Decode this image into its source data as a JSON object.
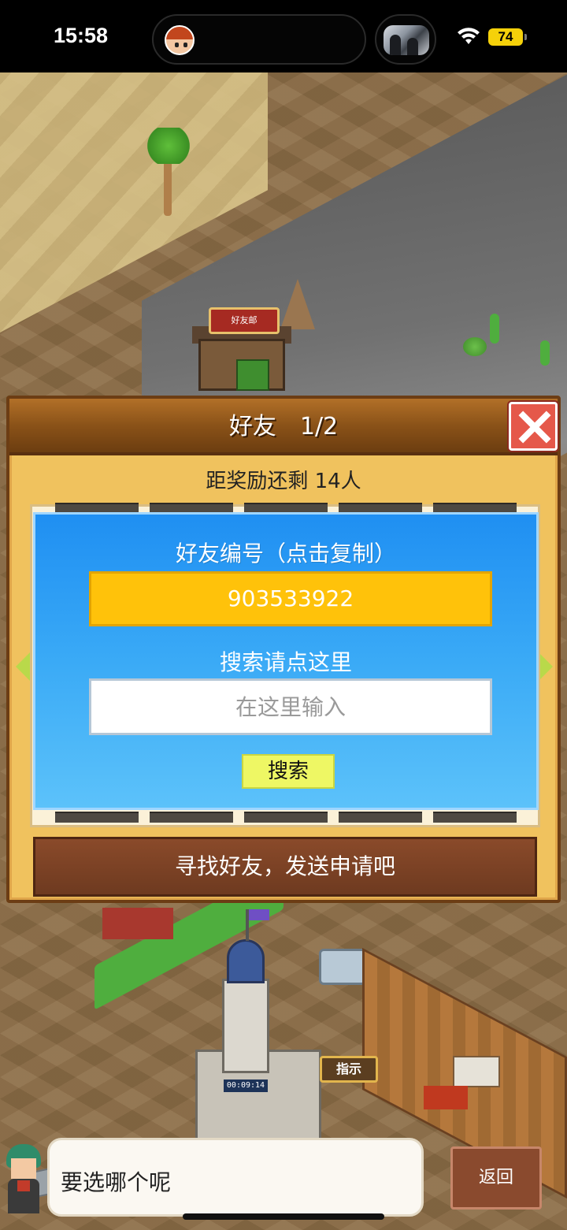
{
  "status_bar": {
    "time": "15:58",
    "battery": "74",
    "battery_color": "#f5d10a"
  },
  "map": {
    "mailbox_sign": "好友邮",
    "timer": "00:09:14",
    "hint_sign": "指示"
  },
  "friend_dialog": {
    "title": "好友　1/2",
    "reward_remaining": "距奖励还剩 14人",
    "id_label": "好友编号（点击复制）",
    "friend_id": "903533922",
    "search_label": "搜索请点这里",
    "search_placeholder": "在这里输入",
    "search_button": "搜索",
    "send_request_banner": "寻找好友，发送申请吧",
    "colors": {
      "panel_top": "#1f8ff2",
      "id_field": "#ffc20a",
      "search_button": "#eef764",
      "close_button": "#e5584a"
    }
  },
  "dialogue": {
    "text": "要选哪个呢",
    "back_button": "返回"
  },
  "icons": {
    "close": "close-icon",
    "prev": "arrow-left-icon",
    "next": "arrow-right-icon",
    "wifi": "wifi-icon"
  }
}
